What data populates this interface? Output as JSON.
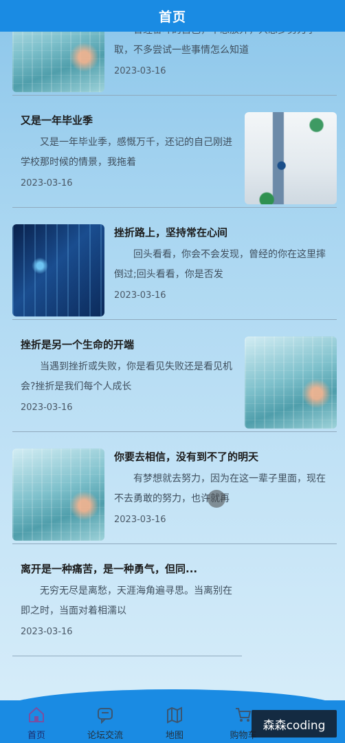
{
  "header": {
    "title": "首页"
  },
  "articles": [
    {
      "title": "",
      "summary": "曾经奋斗的自己，不想放弃，只想多努力争取，不多尝试一些事情怎么知道",
      "date": "2023-03-16"
    },
    {
      "title": "又是一年毕业季",
      "summary": "又是一年毕业季，感慨万千，还记的自己刚进学校那时候的情景，我拖着",
      "date": "2023-03-16"
    },
    {
      "title": "挫折路上，坚持常在心间",
      "summary": "回头看看，你会不会发现，曾经的你在这里摔倒过;回头看看，你是否发",
      "date": "2023-03-16"
    },
    {
      "title": "挫折是另一个生命的开端",
      "summary": "当遇到挫折或失败，你是看见失败还是看见机会?挫折是我们每个人成长",
      "date": "2023-03-16"
    },
    {
      "title": "你要去相信，没有到不了的明天",
      "summary": "有梦想就去努力，因为在这一辈子里面，现在不去勇敢的努力，也许就再",
      "date": "2023-03-16"
    },
    {
      "title": "离开是一种痛苦，是一种勇气，但同...",
      "summary": "无穷无尽是离愁，天涯海角遍寻思。当离别在即之时，当面对着相濡以",
      "date": "2023-03-16"
    }
  ],
  "tabbar": {
    "items": [
      {
        "label": "首页",
        "icon": "home-icon"
      },
      {
        "label": "论坛交流",
        "icon": "chat-icon"
      },
      {
        "label": "地图",
        "icon": "map-icon"
      },
      {
        "label": "购物车",
        "icon": "cart-icon"
      }
    ]
  },
  "watermark": {
    "text": "森森coding"
  },
  "colors": {
    "primary": "#1a8be3"
  }
}
